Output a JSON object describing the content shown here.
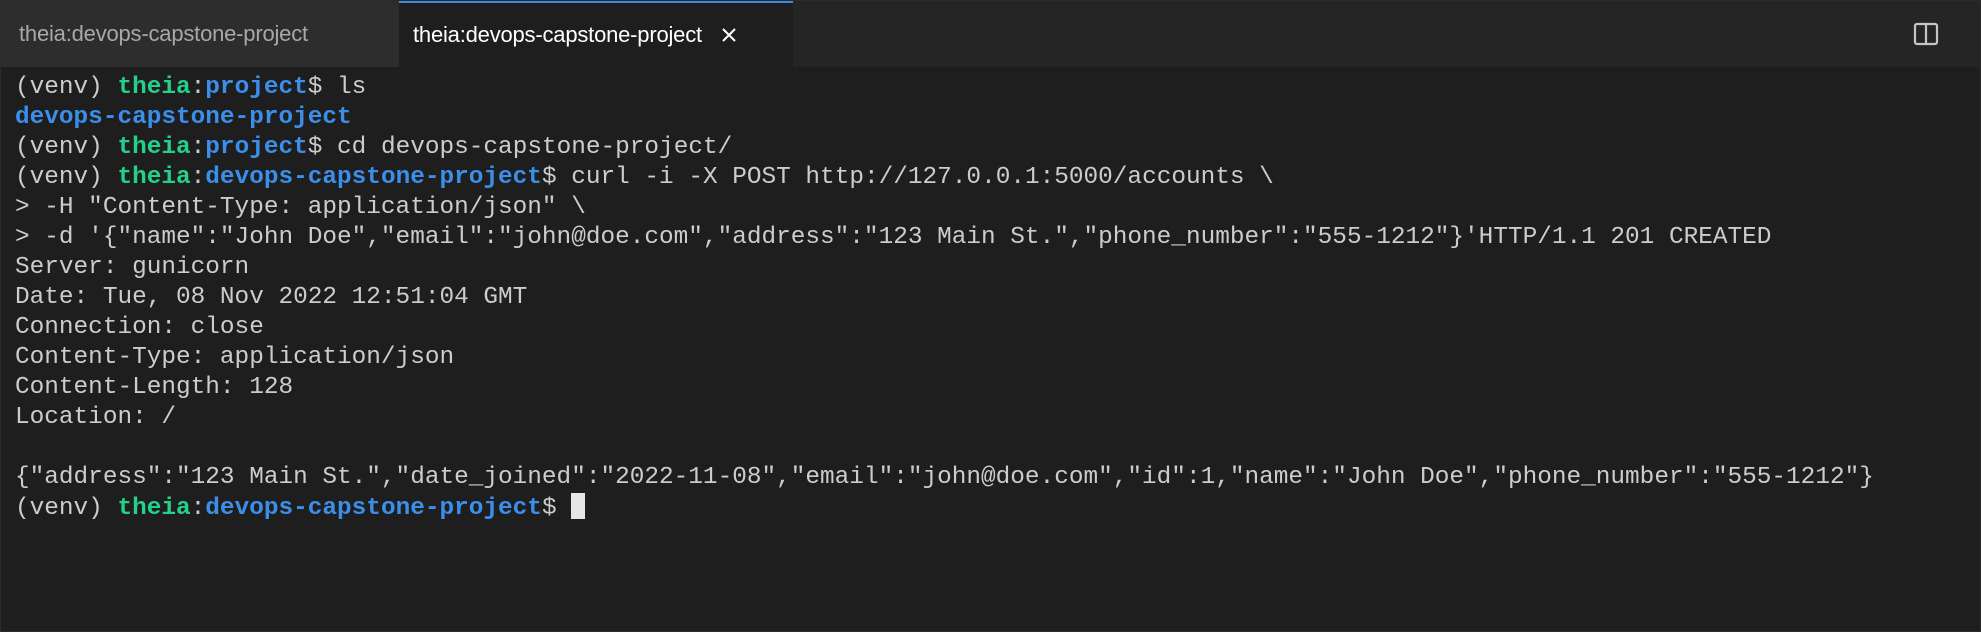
{
  "tabs": [
    {
      "label": "theia:devops-capstone-project",
      "active": false
    },
    {
      "label": "theia:devops-capstone-project",
      "active": true
    }
  ],
  "terminal": {
    "venv": "(venv) ",
    "host": "theia",
    "colon": ":",
    "dollar": "$ ",
    "lines": [
      {
        "kind": "prompt",
        "path": "project",
        "command": "ls"
      },
      {
        "kind": "dir",
        "text": "devops-capstone-project"
      },
      {
        "kind": "prompt",
        "path": "project",
        "command": "cd devops-capstone-project/"
      },
      {
        "kind": "prompt",
        "path": "devops-capstone-project",
        "command": "curl -i -X POST http://127.0.0.1:5000/accounts \\"
      },
      {
        "kind": "text",
        "text": "> -H \"Content-Type: application/json\" \\"
      },
      {
        "kind": "text",
        "text": "> -d '{\"name\":\"John Doe\",\"email\":\"john@doe.com\",\"address\":\"123 Main St.\",\"phone_number\":\"555-1212\"}'HTTP/1.1 201 CREATED"
      },
      {
        "kind": "text",
        "text": "Server: gunicorn"
      },
      {
        "kind": "text",
        "text": "Date: Tue, 08 Nov 2022 12:51:04 GMT"
      },
      {
        "kind": "text",
        "text": "Connection: close"
      },
      {
        "kind": "text",
        "text": "Content-Type: application/json"
      },
      {
        "kind": "text",
        "text": "Content-Length: 128"
      },
      {
        "kind": "text",
        "text": "Location: /"
      },
      {
        "kind": "text",
        "text": ""
      },
      {
        "kind": "text",
        "text": "{\"address\":\"123 Main St.\",\"date_joined\":\"2022-11-08\",\"email\":\"john@doe.com\",\"id\":1,\"name\":\"John Doe\",\"phone_number\":\"555-1212\"}"
      },
      {
        "kind": "prompt",
        "path": "devops-capstone-project",
        "command": "",
        "cursor": true
      }
    ]
  },
  "icons": {
    "tab_close": "close-icon",
    "split": "split-editor-icon"
  },
  "colors": {
    "background": "#1e1e1e",
    "prompt_user": "#23d18b",
    "prompt_path": "#3b8eea",
    "text": "#cccccc",
    "active_tab_border": "#3c8bd9"
  }
}
